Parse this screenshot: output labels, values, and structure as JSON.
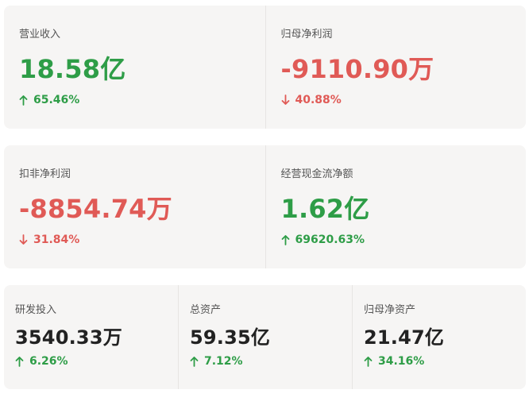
{
  "colors": {
    "positive": "#2e9d47",
    "negative": "#e05a56",
    "label": "#555555",
    "neutral_value": "#222222",
    "card_bg": "#f6f5f4"
  },
  "metrics": {
    "revenue": {
      "label": "营业收入",
      "value": "18.58亿",
      "change": "65.46%",
      "direction": "up",
      "icon": "arrow-up-icon"
    },
    "net_profit_parent": {
      "label": "归母净利润",
      "value": "-9110.90万",
      "change": "40.88%",
      "direction": "down",
      "icon": "arrow-down-icon"
    },
    "net_profit_deducted": {
      "label": "扣非净利润",
      "value": "-8854.74万",
      "change": "31.84%",
      "direction": "down",
      "icon": "arrow-down-icon"
    },
    "operating_cash_flow": {
      "label": "经营现金流净额",
      "value": "1.62亿",
      "change": "69620.63%",
      "direction": "up",
      "icon": "arrow-up-icon"
    },
    "rd_investment": {
      "label": "研发投入",
      "value": "3540.33万",
      "change": "6.26%",
      "direction": "up",
      "icon": "arrow-up-icon"
    },
    "total_assets": {
      "label": "总资产",
      "value": "59.35亿",
      "change": "7.12%",
      "direction": "up",
      "icon": "arrow-up-icon"
    },
    "net_assets_parent": {
      "label": "归母净资产",
      "value": "21.47亿",
      "change": "34.16%",
      "direction": "up",
      "icon": "arrow-up-icon"
    }
  }
}
